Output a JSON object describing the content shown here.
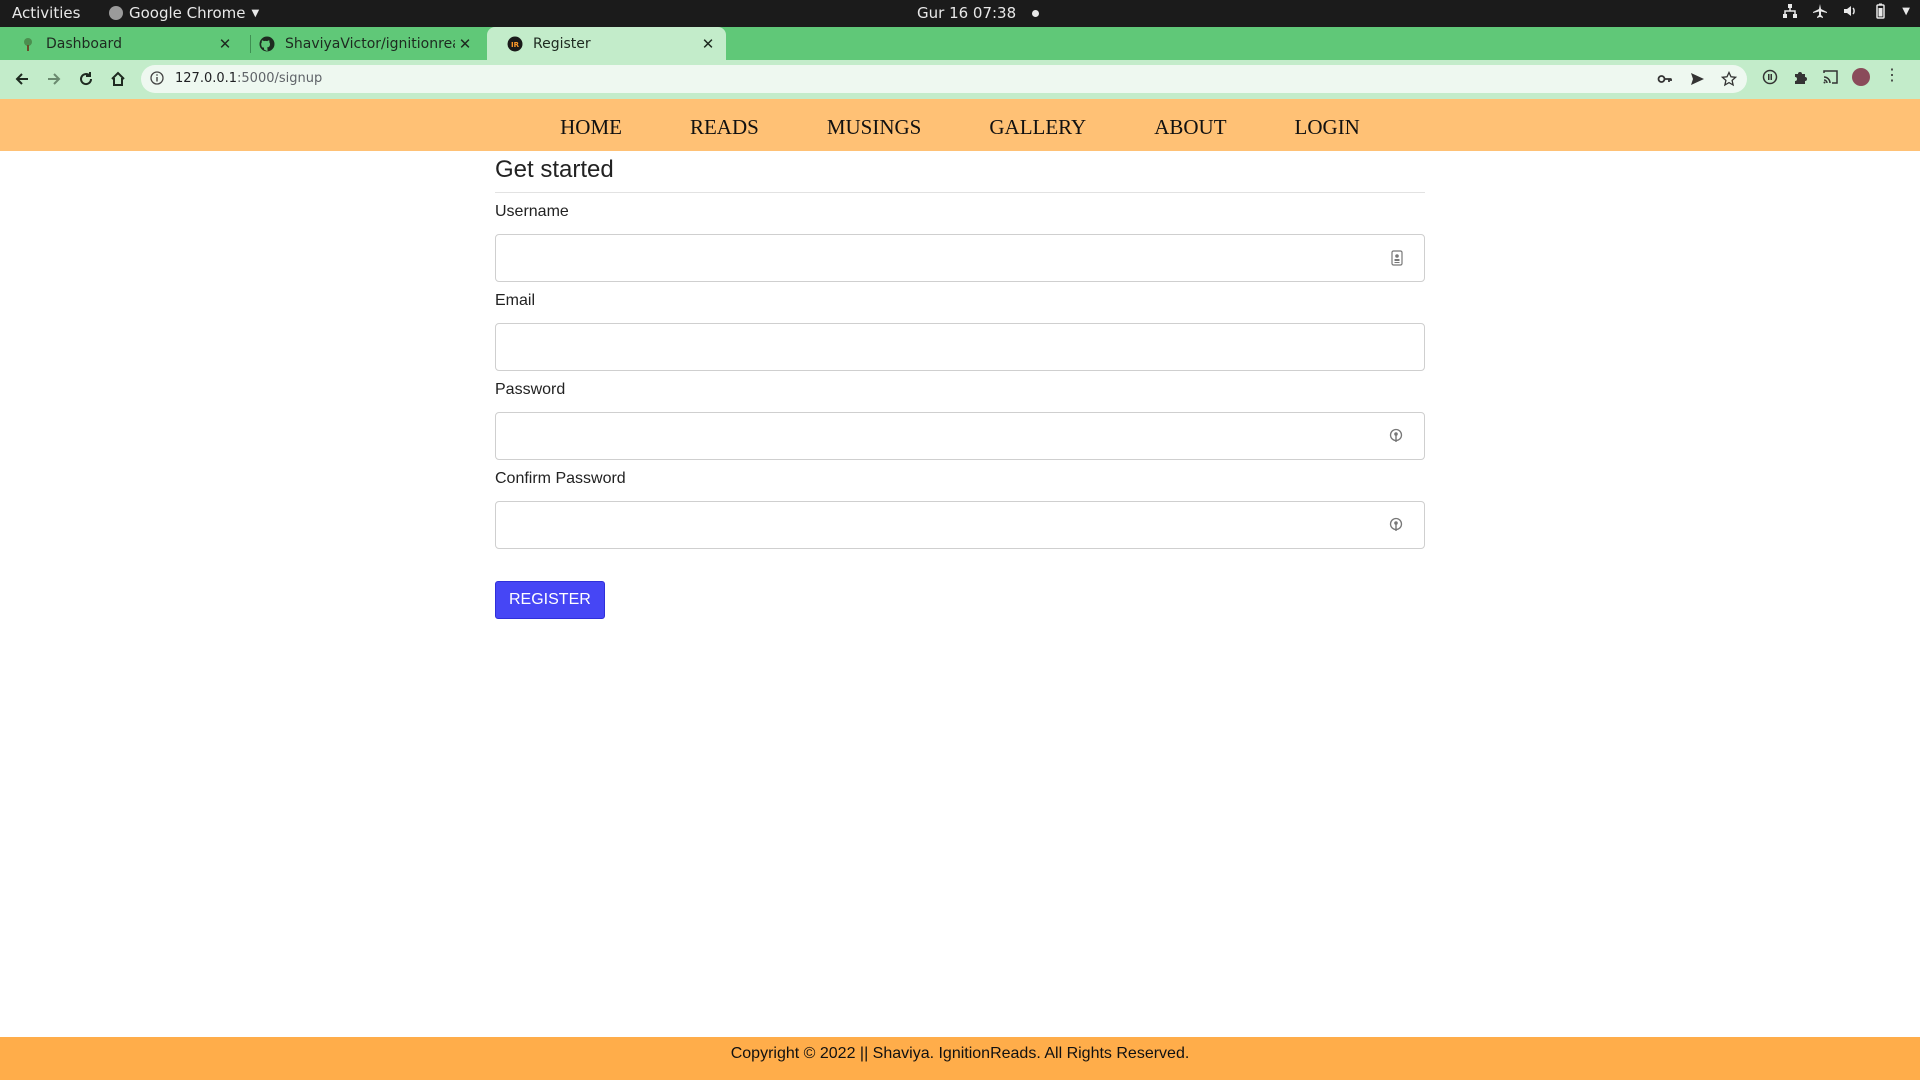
{
  "os_bar": {
    "activities": "Activities",
    "app_name": "Google Chrome",
    "clock": "Gur 16  07:38"
  },
  "browser": {
    "tabs": [
      {
        "title": "Dashboard",
        "favicon": "tree-icon"
      },
      {
        "title": "ShaviyaVictor/ignitionreads",
        "favicon": "github-icon"
      },
      {
        "title": "Register",
        "favicon": "ir-logo-icon"
      }
    ],
    "url_host": "127.0.0.1",
    "url_path": ":5000/signup",
    "accent_color": "#60c878"
  },
  "site_nav": {
    "items": [
      "HOME",
      "READS",
      "MUSINGS",
      "GALLERY",
      "ABOUT",
      "LOGIN"
    ],
    "background": "#ffc175"
  },
  "form": {
    "heading": "Get started",
    "fields": [
      {
        "label": "Username",
        "value": "",
        "icon": "contact-card-icon"
      },
      {
        "label": "Email",
        "value": ""
      },
      {
        "label": "Password",
        "value": "",
        "icon": "key-icon"
      },
      {
        "label": "Confirm Password",
        "value": "",
        "icon": "key-icon"
      }
    ],
    "submit_label": "REGISTER",
    "button_color": "#4646f5"
  },
  "footer": {
    "text": "Copyright © 2022 || Shaviya. IgnitionReads. All Rights Reserved.",
    "background": "#ffad4a"
  }
}
